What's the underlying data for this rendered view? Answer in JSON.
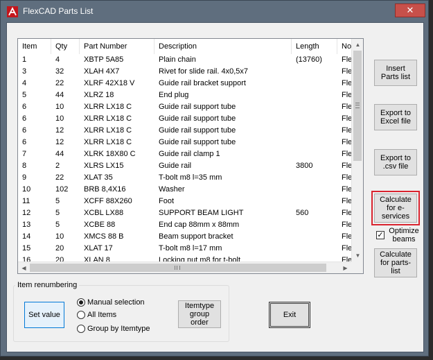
{
  "window": {
    "title": "FlexCAD Parts List",
    "close_label": "✕"
  },
  "list": {
    "columns": [
      "Item",
      "Qty",
      "Part Number",
      "Description",
      "Length",
      "No"
    ],
    "rows": [
      [
        "1",
        "4",
        "XBTP 5A85",
        "Plain chain",
        "(13760)",
        "Fle"
      ],
      [
        "3",
        "32",
        "XLAH 4X7",
        "Rivet for slide rail. 4x0,5x7",
        "",
        "Fle"
      ],
      [
        "4",
        "22",
        "XLRF 42X18 V",
        "Guide rail bracket support",
        "",
        "Fle"
      ],
      [
        "5",
        "44",
        "XLRZ 18",
        "End plug",
        "",
        "Fle"
      ],
      [
        "6",
        "10",
        "XLRR LX18 C",
        "Guide rail support tube",
        "",
        "Fle"
      ],
      [
        "6",
        "10",
        "XLRR LX18 C",
        "Guide rail support tube",
        "",
        "Fle"
      ],
      [
        "6",
        "12",
        "XLRR LX18 C",
        "Guide rail support tube",
        "",
        "Fle"
      ],
      [
        "6",
        "12",
        "XLRR LX18 C",
        "Guide rail support tube",
        "",
        "Fle"
      ],
      [
        "7",
        "44",
        "XLRK 18X80 C",
        "Guide rail clamp 1",
        "",
        "Fle"
      ],
      [
        "8",
        "2",
        "XLRS LX15",
        "Guide rail",
        "3800",
        "Fle"
      ],
      [
        "9",
        "22",
        "XLAT 35",
        "T-bolt m8 l=35 mm",
        "",
        "Fle"
      ],
      [
        "10",
        "102",
        "BRB 8,4X16",
        "Washer",
        "",
        "Fle"
      ],
      [
        "11",
        "5",
        "XCFF 88X260",
        "Foot",
        "",
        "Fle"
      ],
      [
        "12",
        "5",
        "XCBL LX88",
        "SUPPORT BEAM LIGHT",
        "560",
        "Fle"
      ],
      [
        "13",
        "5",
        "XCBE 88",
        "End cap 88mm x 88mm",
        "",
        "Fle"
      ],
      [
        "14",
        "10",
        "XMCS 88 B",
        "Beam support bracket",
        "",
        "Fle"
      ],
      [
        "15",
        "20",
        "XLAT 17",
        "T-bolt m8 l=17 mm",
        "",
        "Fle"
      ],
      [
        "16",
        "20",
        "XLAN 8",
        "Locking nut m8 for t-bolt",
        "",
        "Fle"
      ]
    ]
  },
  "side_buttons": {
    "insert": "Insert Parts list",
    "export_excel": "Export to Excel file",
    "export_csv": "Export to .csv file",
    "calc_eservices": "Calculate for e-services",
    "optimize_label": "Optimize beams",
    "optimize_checked": true,
    "calc_partslist": "Calculate for parts-list"
  },
  "renumbering": {
    "title": "Item renumbering",
    "set_value": "Set value",
    "options": [
      "Manual selection",
      "All Items",
      "Group by Itemtype"
    ],
    "selected_index": 0,
    "itemtype_group_order": "Itemtype group order"
  },
  "exit_label": "Exit",
  "colors": {
    "highlight": "#d9232e",
    "title_bar": "#5f6e7e",
    "close": "#c7504a"
  }
}
